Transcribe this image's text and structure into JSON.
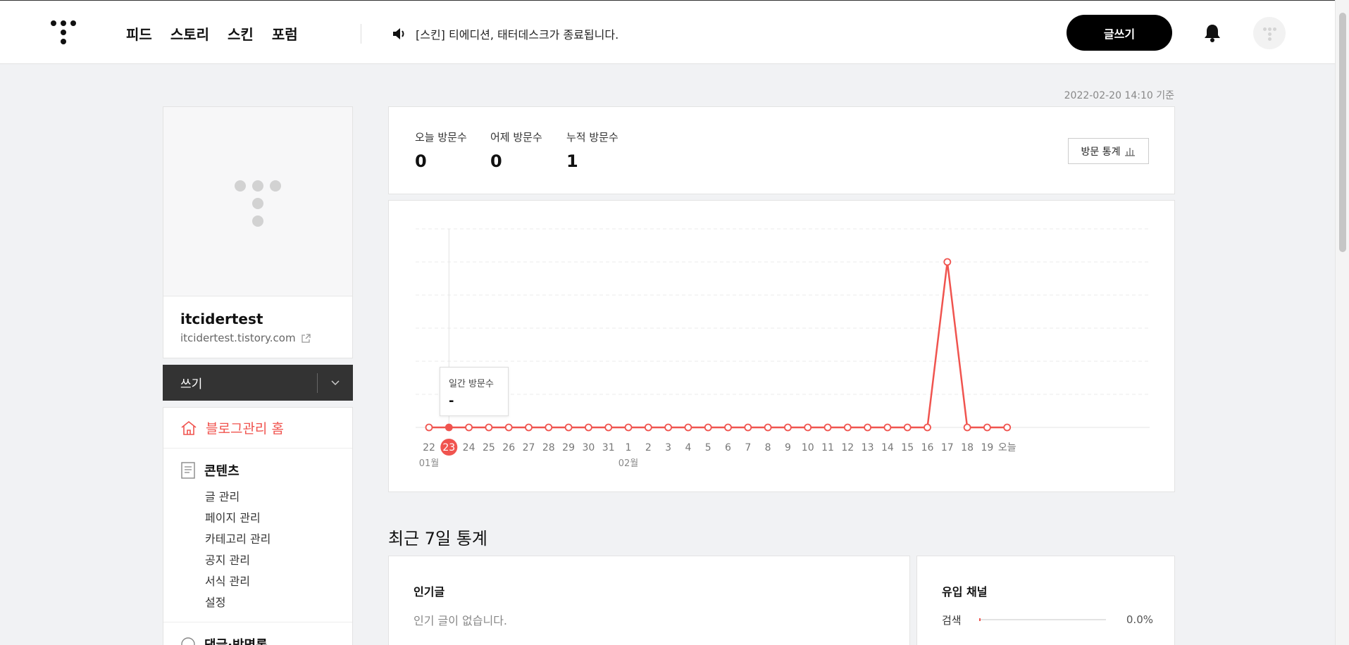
{
  "nav": {
    "items": [
      "피드",
      "스토리",
      "스킨",
      "포럼"
    ],
    "notice": "[스킨] 티에디션, 태터데스크가 종료됩니다.",
    "write_label": "글쓰기"
  },
  "basis": "2022-02-20 14:10 기준",
  "profile": {
    "blog_name": "itcidertest",
    "blog_url": "itcidertest.tistory.com"
  },
  "write_bar": {
    "label": "쓰기"
  },
  "menu": {
    "home": "블로그관리 홈",
    "contents": {
      "title": "콘텐츠",
      "items": [
        "글 관리",
        "페이지 관리",
        "카테고리 관리",
        "공지 관리",
        "서식 관리",
        "설정"
      ]
    },
    "next_title": "댓글·방명록"
  },
  "stats": {
    "today": {
      "label": "오늘 방문수",
      "value": "0"
    },
    "yesterday": {
      "label": "어제 방문수",
      "value": "0"
    },
    "total": {
      "label": "누적 방문수",
      "value": "1"
    },
    "button": "방문 통계"
  },
  "chart_data": {
    "type": "line",
    "categories": [
      "22",
      "23",
      "24",
      "25",
      "26",
      "27",
      "28",
      "29",
      "30",
      "31",
      "1",
      "2",
      "3",
      "4",
      "5",
      "6",
      "7",
      "8",
      "9",
      "10",
      "11",
      "12",
      "13",
      "14",
      "15",
      "16",
      "17",
      "18",
      "19",
      "오늘"
    ],
    "month_labels": [
      {
        "at": "22",
        "label": "01월"
      },
      {
        "at": "1",
        "label": "02월"
      }
    ],
    "series": [
      {
        "values": [
          0,
          0,
          0,
          0,
          0,
          0,
          0,
          0,
          0,
          0,
          0,
          0,
          0,
          0,
          0,
          0,
          0,
          0,
          0,
          0,
          0,
          0,
          0,
          0,
          0,
          0,
          1,
          0,
          0,
          0
        ]
      }
    ],
    "highlighted": "23",
    "ylim": [
      0,
      1.2
    ],
    "grid": true,
    "color": "#f0544f"
  },
  "tooltip": {
    "title": "일간 방문수",
    "value": "-"
  },
  "recent_title": "최근 7일 통계",
  "popular": {
    "title": "인기글",
    "empty": "인기 글이 없습니다."
  },
  "channel": {
    "title": "유입 채널",
    "rows": [
      {
        "name": "검색",
        "percent": "0.0%"
      }
    ]
  }
}
